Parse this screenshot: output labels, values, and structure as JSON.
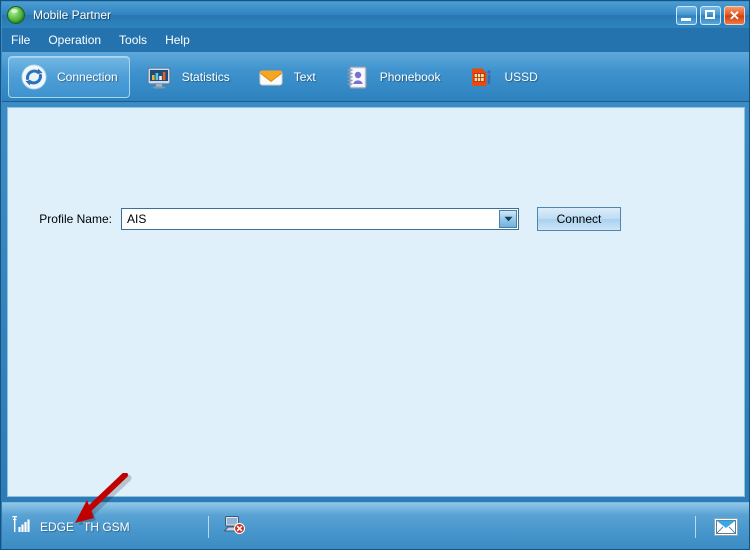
{
  "window": {
    "title": "Mobile Partner",
    "app_icon": "globe-green-icon",
    "controls": {
      "minimize": "minimize-icon",
      "maximize": "maximize-icon",
      "close": "✕"
    },
    "accent_color": "#2573ae",
    "frame_color": "#3184c0",
    "close_color": "#e5541f"
  },
  "menu": {
    "items": [
      {
        "label": "File"
      },
      {
        "label": "Operation"
      },
      {
        "label": "Tools"
      },
      {
        "label": "Help"
      }
    ]
  },
  "toolbar": {
    "tabs": [
      {
        "label": "Connection",
        "icon": "sync-arrows-icon",
        "active": true
      },
      {
        "label": "Statistics",
        "icon": "monitor-chart-icon",
        "active": false
      },
      {
        "label": "Text",
        "icon": "envelope-orange-icon",
        "active": false
      },
      {
        "label": "Phonebook",
        "icon": "contacts-book-icon",
        "active": false
      },
      {
        "label": "USSD",
        "icon": "sim-card-info-icon",
        "active": false
      }
    ]
  },
  "content": {
    "background_color": "#dff0fb",
    "profile": {
      "label": "Profile Name:",
      "value": "AIS",
      "placeholder": "",
      "options": [
        "AIS"
      ],
      "dropdown_icon": "chevron-down-icon"
    },
    "connect_button_label": "Connect"
  },
  "status_bar": {
    "signal_icon": "signal-bars-icon",
    "network_mode": "EDGE",
    "operator": "TH GSM",
    "connection_icon": "computer-disconnected-icon",
    "message_icon": "envelope-icon"
  },
  "annotation": {
    "arrow_color": "#c00000",
    "arrow_target": "network-mode-status"
  }
}
